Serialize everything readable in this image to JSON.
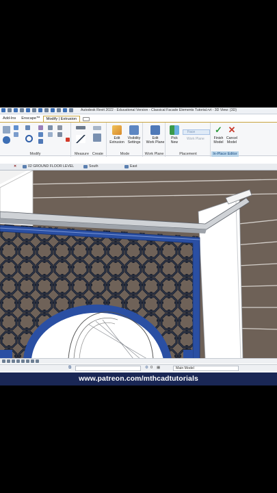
{
  "window": {
    "title": "Autodesk Revit 2022 - Educational Version - Classical Facade Elements Tutorial.rvt - 3D View: {3D}"
  },
  "ribbon_tabs": [
    {
      "label": "Add-Ins"
    },
    {
      "label": "Enscape™"
    },
    {
      "label": "Modify | Extrusion"
    }
  ],
  "ribbon": {
    "modify_panel_label": "Modify",
    "measure_label": "Measure",
    "create_label": "Create",
    "mode_panel_label": "Mode",
    "edit_extrusion_label": "Edit\nExtrusion",
    "visibility_settings_label": "Visibility\nSettings",
    "workplane_panel_label": "Work Plane",
    "edit_workplane_label": "Edit\nWork Plane",
    "placement_panel_label": "Placement",
    "pick_new_label": "Pick\nNew",
    "face_label": "Face",
    "work_plane_label": "Work Plane",
    "finish_model_label": "Finish\nModel",
    "cancel_model_label": "Cancel\nModel",
    "inplace_editor_label": "In-Place Editor"
  },
  "view_tabs": [
    {
      "label": "02 GROUND FLOOR LEVEL"
    },
    {
      "label": "South"
    },
    {
      "label": "East"
    }
  ],
  "status": {
    "zero_value": "0",
    "model_select": "Main Model"
  },
  "banner": {
    "text": "www.patreon.com/mthcadtutorials"
  },
  "colors": {
    "accent_tab": "#c7a23d",
    "frame_blue": "#2a4fa3",
    "lattice": "#1c2230",
    "wall_brown": "#6f6258",
    "banner_bg": "#1a2755",
    "finish_green": "#2e9a3d",
    "cancel_red": "#c83a2c"
  }
}
